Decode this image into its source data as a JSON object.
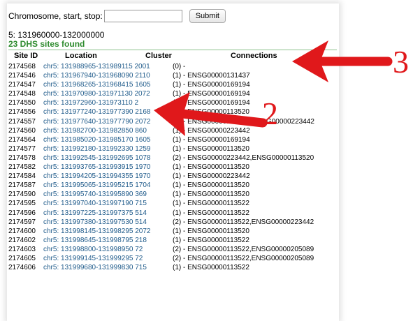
{
  "query": {
    "label": "Chromosome, start, stop:",
    "input_value": "",
    "submit_label": "Submit"
  },
  "results": {
    "range": "5: 131960000-132000000",
    "count_text": "23 DHS sites found",
    "headers": {
      "site_id": "Site ID",
      "location": "Location",
      "cluster": "Cluster",
      "connections": "Connections"
    },
    "rows": [
      {
        "id": "2174568",
        "location": "chr5: 131988965-131989115",
        "cluster": "2001",
        "conn": "(0) -"
      },
      {
        "id": "2174546",
        "location": "chr5: 131967940-131968090",
        "cluster": "2110",
        "conn": "(1) - ENSG00000131437"
      },
      {
        "id": "2174547",
        "location": "chr5: 131968265-131968415",
        "cluster": "1605",
        "conn": "(1) - ENSG00000169194"
      },
      {
        "id": "2174548",
        "location": "chr5: 131970980-131971130",
        "cluster": "2072",
        "conn": "(1) - ENSG00000169194"
      },
      {
        "id": "2174550",
        "location": "chr5: 131972960-131973110",
        "cluster": "2",
        "conn": "(1) - ENSG00000169194"
      },
      {
        "id": "2174556",
        "location": "chr5: 131977240-131977390",
        "cluster": "2168",
        "conn": "(1) - ENSG00000113520"
      },
      {
        "id": "2174557",
        "location": "chr5: 131977640-131977790",
        "cluster": "2072",
        "conn": "(2) - ENSG00000169194,ENSG00000223442"
      },
      {
        "id": "2174560",
        "location": "chr5: 131982700-131982850",
        "cluster": "860",
        "conn": "(1) - ENSG00000223442"
      },
      {
        "id": "2174564",
        "location": "chr5: 131985020-131985170",
        "cluster": "1605",
        "conn": "(1) - ENSG00000169194"
      },
      {
        "id": "2174577",
        "location": "chr5: 131992180-131992330",
        "cluster": "1259",
        "conn": "(1) - ENSG00000113520"
      },
      {
        "id": "2174578",
        "location": "chr5: 131992545-131992695",
        "cluster": "1078",
        "conn": "(2) - ENSG00000223442,ENSG00000113520"
      },
      {
        "id": "2174582",
        "location": "chr5: 131993765-131993915",
        "cluster": "1970",
        "conn": "(1) - ENSG00000113520"
      },
      {
        "id": "2174584",
        "location": "chr5: 131994205-131994355",
        "cluster": "1970",
        "conn": "(1) - ENSG00000223442"
      },
      {
        "id": "2174587",
        "location": "chr5: 131995065-131995215",
        "cluster": "1704",
        "conn": "(1) - ENSG00000113520"
      },
      {
        "id": "2174590",
        "location": "chr5: 131995740-131995890",
        "cluster": "369",
        "conn": "(1) - ENSG00000113520"
      },
      {
        "id": "2174595",
        "location": "chr5: 131997040-131997190",
        "cluster": "715",
        "conn": "(1) - ENSG00000113522"
      },
      {
        "id": "2174596",
        "location": "chr5: 131997225-131997375",
        "cluster": "514",
        "conn": "(1) - ENSG00000113522"
      },
      {
        "id": "2174597",
        "location": "chr5: 131997380-131997530",
        "cluster": "514",
        "conn": "(2) - ENSG00000113522,ENSG00000223442"
      },
      {
        "id": "2174600",
        "location": "chr5: 131998145-131998295",
        "cluster": "2072",
        "conn": "(1) - ENSG00000113520"
      },
      {
        "id": "2174602",
        "location": "chr5: 131998645-131998795",
        "cluster": "218",
        "conn": "(1) - ENSG00000113522"
      },
      {
        "id": "2174603",
        "location": "chr5: 131998800-131998950",
        "cluster": "72",
        "conn": "(2) - ENSG00000113522,ENSG00000205089"
      },
      {
        "id": "2174605",
        "location": "chr5: 131999145-131999295",
        "cluster": "72",
        "conn": "(2) - ENSG00000113522,ENSG00000205089"
      },
      {
        "id": "2174606",
        "location": "chr5: 131999680-131999830",
        "cluster": "715",
        "conn": "(1) - ENSG00000113522"
      }
    ]
  },
  "annotations": {
    "callout_2": "2",
    "callout_3": "3",
    "arrow_color": "#e0181b"
  }
}
